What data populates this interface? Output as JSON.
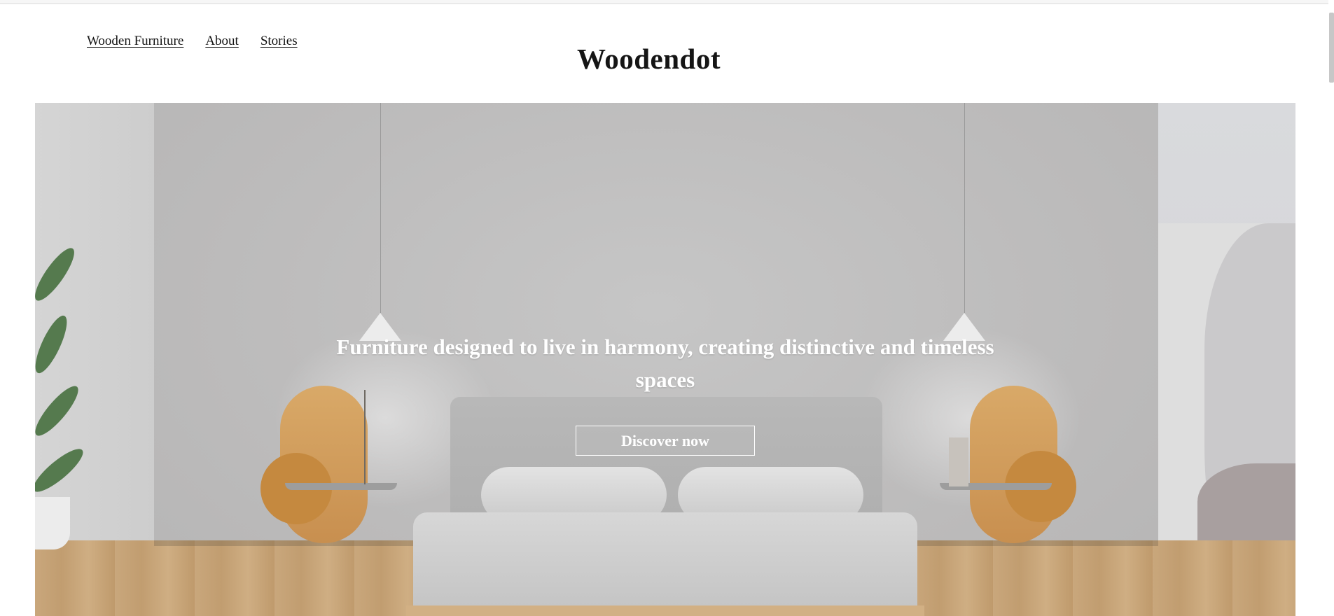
{
  "nav": {
    "items": [
      {
        "label": "Wooden Furniture"
      },
      {
        "label": "About"
      },
      {
        "label": "Stories"
      }
    ]
  },
  "brand": {
    "logo_text": "Woodendot"
  },
  "hero": {
    "headline": "Furniture designed to live in harmony, creating distinctive and timeless spaces",
    "cta_label": "Discover now"
  }
}
